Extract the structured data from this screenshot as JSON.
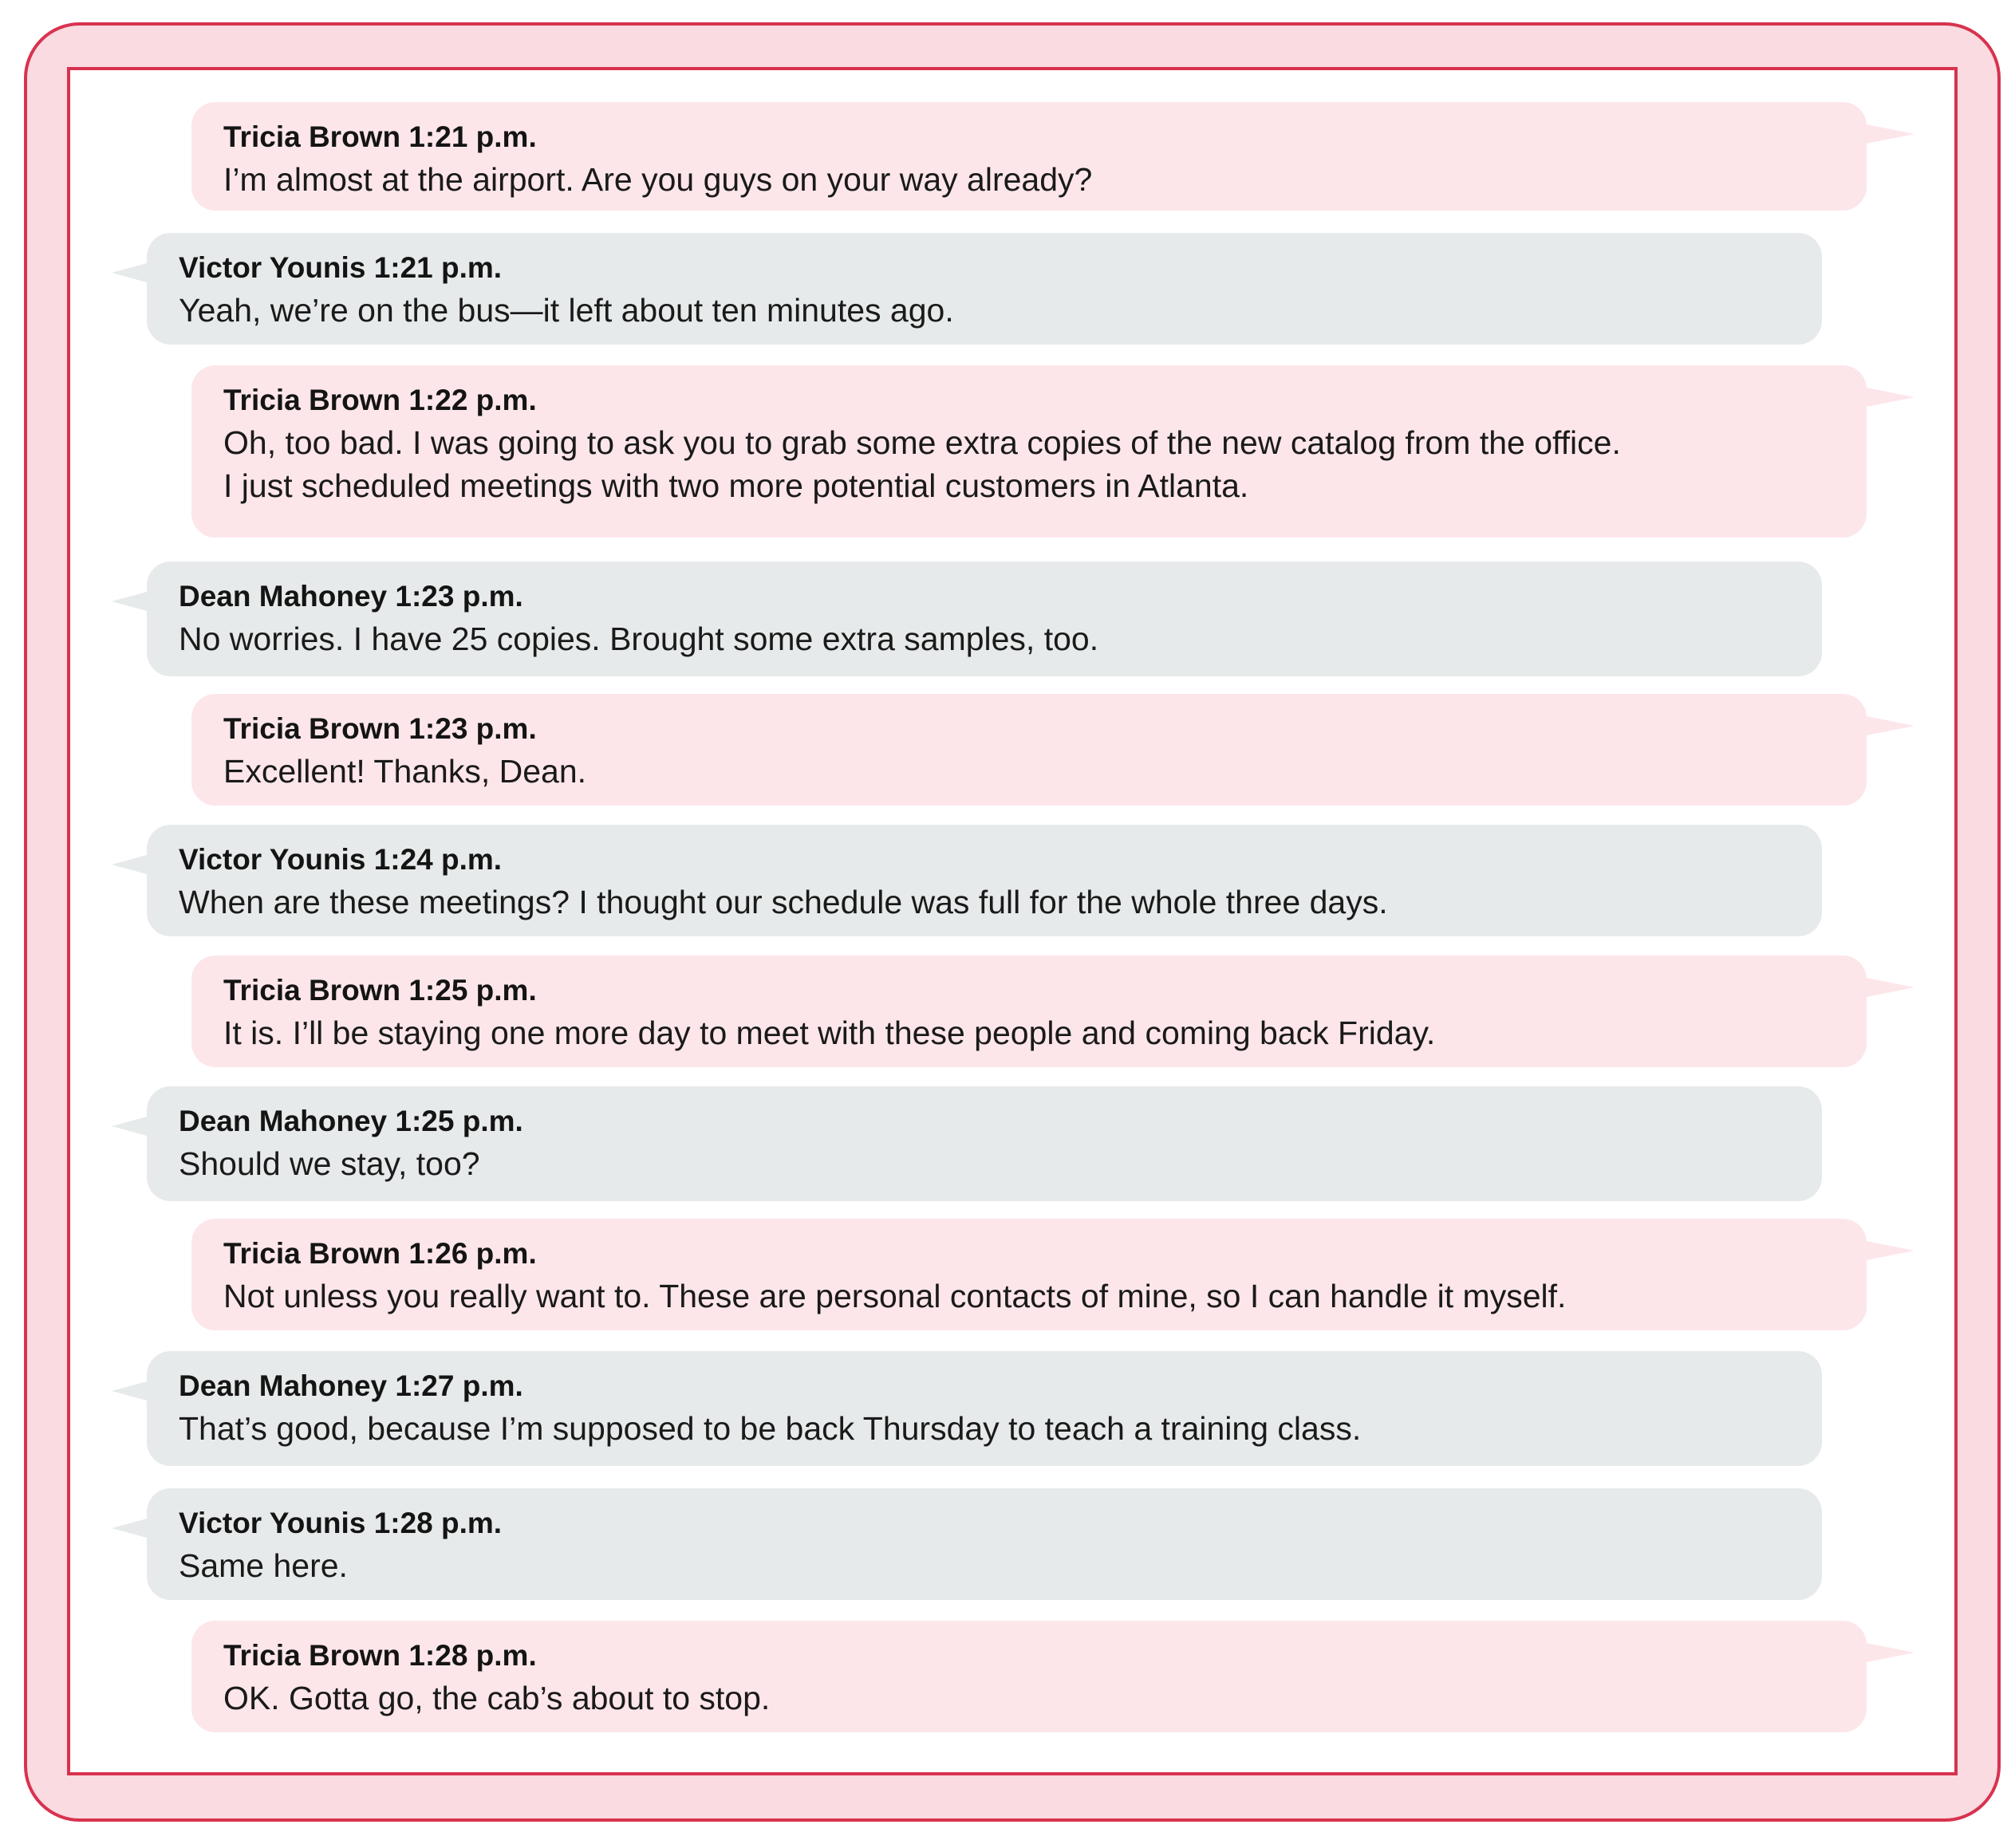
{
  "messages": [
    {
      "author": "Tricia Brown",
      "time": "1:21 p.m.",
      "text": "I’m almost at the airport. Are you guys on your way already?",
      "style": "pink"
    },
    {
      "author": "Victor Younis",
      "time": "1:21 p.m.",
      "text": "Yeah, we’re on the bus—it left about ten minutes ago.",
      "style": "gray"
    },
    {
      "author": "Tricia Brown",
      "time": "1:22 p.m.",
      "text": "Oh, too bad. I was going to ask you to grab some extra copies of the new catalog from the office.\nI just scheduled meetings with two more potential customers in Atlanta.",
      "style": "pink"
    },
    {
      "author": "Dean Mahoney",
      "time": "1:23 p.m.",
      "text": "No worries. I have 25 copies. Brought some extra samples, too.",
      "style": "gray"
    },
    {
      "author": "Tricia Brown",
      "time": "1:23 p.m.",
      "text": "Excellent! Thanks, Dean.",
      "style": "pink"
    },
    {
      "author": "Victor Younis",
      "time": "1:24 p.m.",
      "text": "When are these meetings? I thought our schedule was full for the whole three days.",
      "style": "gray"
    },
    {
      "author": "Tricia Brown",
      "time": "1:25 p.m.",
      "text": "It is. I’ll be staying one more day to meet with these people and coming back Friday.",
      "style": "pink"
    },
    {
      "author": "Dean Mahoney",
      "time": "1:25 p.m.",
      "text": "Should we stay, too?",
      "style": "gray"
    },
    {
      "author": "Tricia Brown",
      "time": "1:26 p.m.",
      "text": "Not unless you really want to. These are personal contacts of mine, so I can handle it myself.",
      "style": "pink"
    },
    {
      "author": "Dean Mahoney",
      "time": "1:27 p.m.",
      "text": "That’s good, because I’m supposed to be back Thursday to teach a training class.",
      "style": "gray"
    },
    {
      "author": "Victor Younis",
      "time": "1:28 p.m.",
      "text": "Same here.",
      "style": "gray"
    },
    {
      "author": "Tricia Brown",
      "time": "1:28 p.m.",
      "text": "OK. Gotta go, the cab’s about to stop.",
      "style": "pink"
    }
  ],
  "colors": {
    "frame_border": "#d8324f",
    "frame_fill": "#f9dbe1",
    "bubble_pink": "#fde6ea",
    "bubble_gray": "#e7eaea"
  }
}
